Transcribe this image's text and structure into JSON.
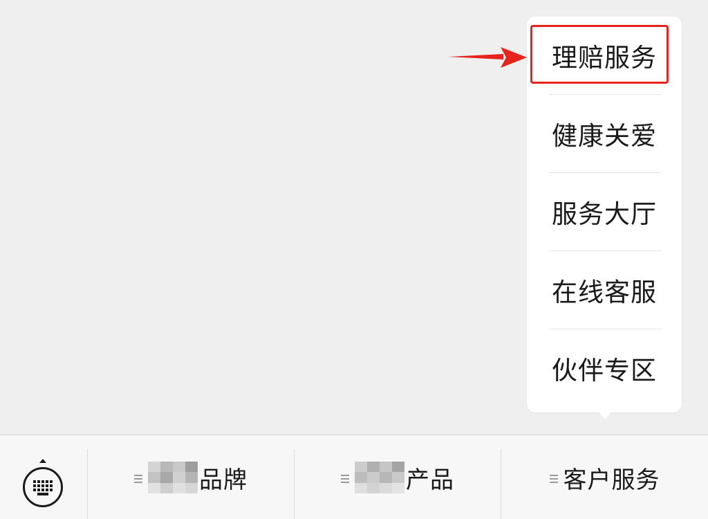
{
  "popup_menu": {
    "items": [
      {
        "label": "理赔服务",
        "highlighted": true
      },
      {
        "label": "健康关爱"
      },
      {
        "label": "服务大厅"
      },
      {
        "label": "在线客服"
      },
      {
        "label": "伙伴专区"
      }
    ]
  },
  "annotation": {
    "color": "#e8231c"
  },
  "bottom_bar": {
    "keyboard_icon": "keyboard-icon",
    "tabs": [
      {
        "label": "品牌",
        "prefix_redacted": true,
        "icon": "menu-lines-icon"
      },
      {
        "label": "产品",
        "prefix_redacted": true,
        "icon": "menu-lines-icon"
      },
      {
        "label": "客户服务",
        "prefix_redacted": false,
        "icon": "menu-lines-icon"
      }
    ]
  }
}
